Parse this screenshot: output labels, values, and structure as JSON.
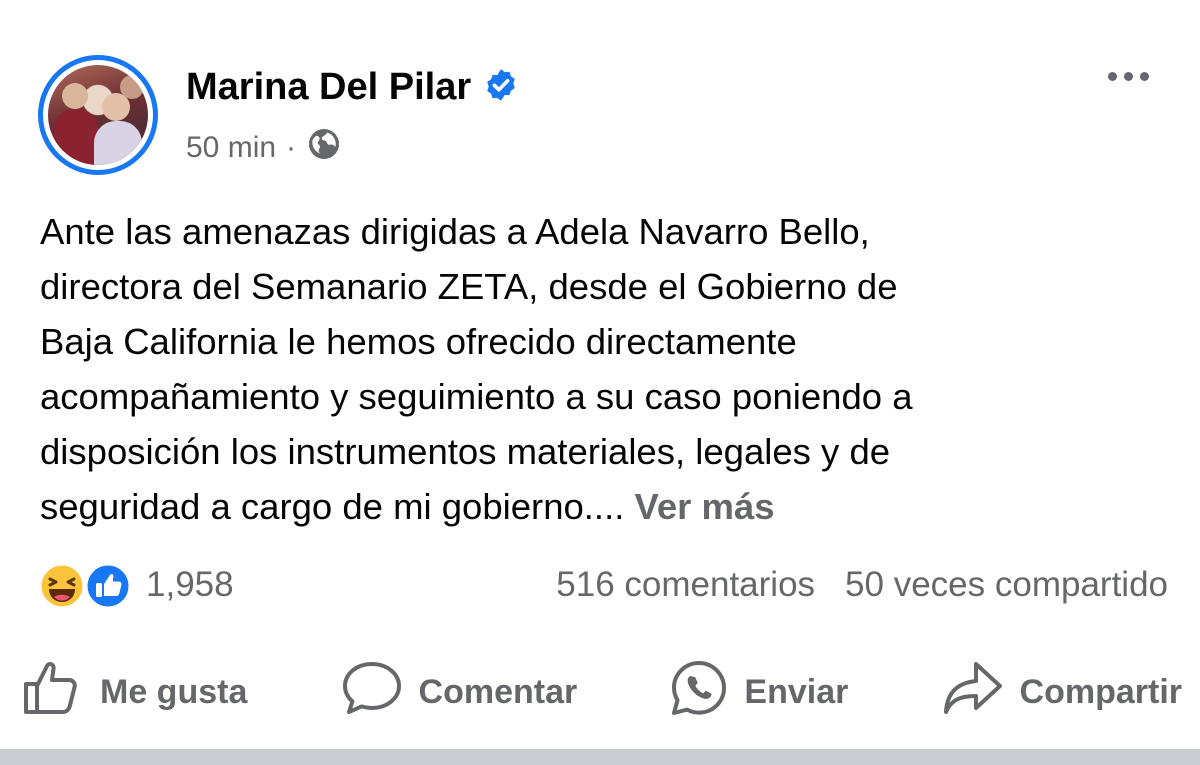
{
  "post": {
    "author": "Marina Del Pilar",
    "verified": true,
    "time": "50 min",
    "separator": "·",
    "audience_icon": "globe-icon",
    "more_icon": "more-horizontal-icon",
    "text_lines": [
      "Ante las amenazas dirigidas a Adela Navarro Bello,",
      "directora del Semanario ZETA, desde el Gobierno de",
      "Baja California le hemos ofrecido directamente",
      "acompañamiento y seguimiento a su caso poniendo a",
      "disposición los instrumentos materiales, legales y de",
      "seguridad a cargo de mi gobierno...."
    ],
    "see_more": "Ver más"
  },
  "stats": {
    "reaction_icons": [
      "haha-icon",
      "like-icon"
    ],
    "reactions": "1,958",
    "comments": "516 comentarios",
    "shares": "50 veces compartido"
  },
  "actions": {
    "like": "Me gusta",
    "comment": "Comentar",
    "send": "Enviar",
    "share": "Compartir"
  },
  "colors": {
    "accent": "#1877f2",
    "secondary_text": "#65676b",
    "primary_text": "#050505"
  }
}
